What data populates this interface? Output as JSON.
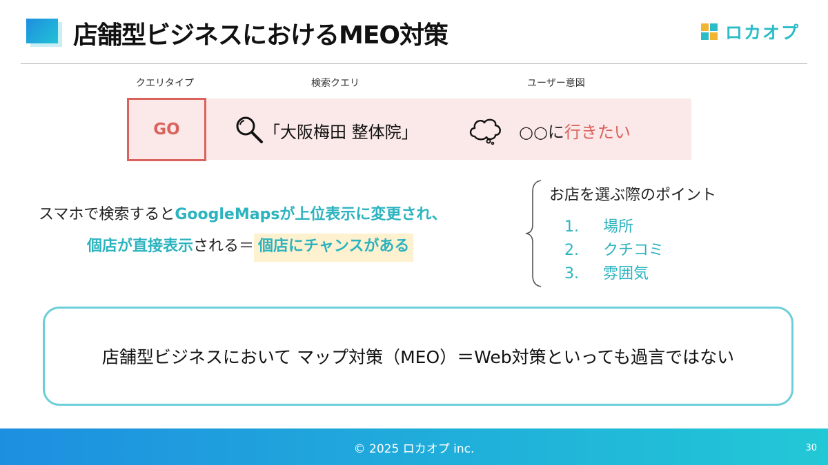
{
  "header": {
    "title": "店舗型ビジネスにおけるMEO対策",
    "logo_text": "ロカオプ"
  },
  "columns": {
    "query_type_label": "クエリタイプ",
    "search_query_label": "検索クエリ",
    "user_intent_label": "ユーザー意図"
  },
  "query_row": {
    "type": "GO",
    "search_query": "「大阪梅田 整体院」",
    "intent_prefix": "○○に",
    "intent_highlight": "行きたい"
  },
  "description": {
    "line1_plain": "スマホで検索すると",
    "line1_emph": "GoogleMapsが上位表示に変更され、",
    "line2_emph": "個店が直接表示",
    "line2_plain": "される＝",
    "line2_highlight": "個店にチャンスがある"
  },
  "points": {
    "title": "お店を選ぶ際のポイント",
    "items": [
      {
        "num": "1.",
        "label": "場所"
      },
      {
        "num": "2.",
        "label": "クチコミ"
      },
      {
        "num": "3.",
        "label": "雰囲気"
      }
    ]
  },
  "callout": {
    "text": "店舗型ビジネスにおいて マップ対策（MEO）＝Web対策といっても過言ではない"
  },
  "footer": {
    "copyright": "© 2025 ロカオプ inc.",
    "page_number": "30"
  },
  "colors": {
    "accent_teal": "#2bb3bf",
    "accent_red": "#d9625c",
    "band_pink": "#fbe8e8",
    "highlight_yellow": "#fdf1cf"
  }
}
